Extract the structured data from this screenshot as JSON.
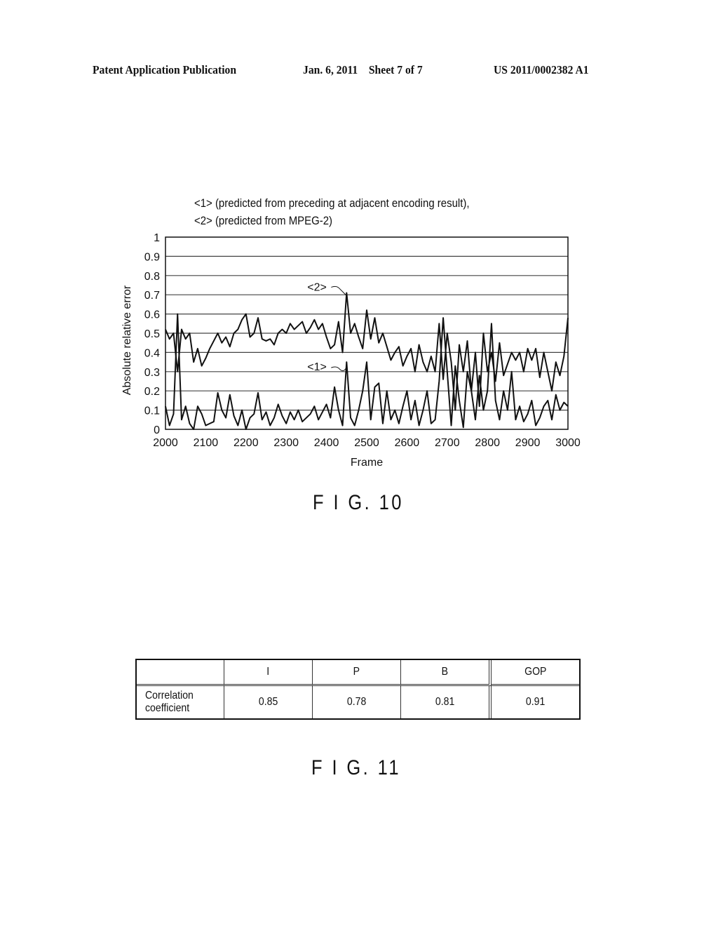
{
  "header": {
    "publication": "Patent Application Publication",
    "date_sheet": "Jan. 6, 2011    Sheet 7 of 7",
    "patent_number": "US 2011/0002382 A1"
  },
  "fig10": {
    "label": "F I G. 10"
  },
  "fig11": {
    "label": "F I G. 11"
  },
  "chart_data": {
    "type": "line",
    "title": "",
    "legend_text": [
      "<1> (predicted from preceding at adjacent encoding result),",
      "<2> (predicted from MPEG-2)"
    ],
    "xlabel": "Frame",
    "ylabel": "Absolute relative error",
    "xlim": [
      2000,
      3000
    ],
    "ylim": [
      0,
      1
    ],
    "x_ticks": [
      "2000",
      "2100",
      "2200",
      "2300",
      "2400",
      "2500",
      "2600",
      "2700",
      "2800",
      "2900",
      "3000"
    ],
    "y_ticks": [
      "0",
      "0.1",
      "0.2",
      "0.3",
      "0.4",
      "0.5",
      "0.6",
      "0.7",
      "0.8",
      "0.9",
      "1"
    ],
    "grid": "horizontal",
    "annotations": [
      {
        "text": "<2>",
        "x": 2450,
        "y": 0.71
      },
      {
        "text": "<1>",
        "x": 2450,
        "y": 0.35
      }
    ],
    "x": [
      2000,
      2010,
      2020,
      2030,
      2040,
      2050,
      2060,
      2070,
      2080,
      2090,
      2100,
      2110,
      2120,
      2130,
      2140,
      2150,
      2160,
      2170,
      2180,
      2190,
      2200,
      2210,
      2220,
      2230,
      2240,
      2250,
      2260,
      2270,
      2280,
      2290,
      2300,
      2310,
      2320,
      2330,
      2340,
      2350,
      2360,
      2370,
      2380,
      2390,
      2400,
      2410,
      2420,
      2430,
      2440,
      2450,
      2460,
      2470,
      2480,
      2490,
      2500,
      2510,
      2520,
      2530,
      2540,
      2550,
      2560,
      2570,
      2580,
      2590,
      2600,
      2610,
      2620,
      2630,
      2640,
      2650,
      2660,
      2670,
      2680,
      2690,
      2700,
      2710,
      2720,
      2730,
      2740,
      2750,
      2760,
      2770,
      2780,
      2790,
      2800,
      2810,
      2820,
      2830,
      2840,
      2850,
      2860,
      2870,
      2880,
      2890,
      2900,
      2910,
      2920,
      2930,
      2940,
      2950,
      2960,
      2970,
      2980,
      2990,
      3000
    ],
    "series": [
      {
        "name": "<1>",
        "values": [
          0.12,
          0.02,
          0.08,
          0.6,
          0.05,
          0.12,
          0.03,
          0.0,
          0.12,
          0.08,
          0.02,
          0.03,
          0.04,
          0.19,
          0.1,
          0.06,
          0.18,
          0.07,
          0.02,
          0.1,
          0.0,
          0.06,
          0.08,
          0.19,
          0.05,
          0.09,
          0.02,
          0.06,
          0.13,
          0.07,
          0.03,
          0.09,
          0.05,
          0.1,
          0.04,
          0.06,
          0.08,
          0.12,
          0.05,
          0.09,
          0.13,
          0.06,
          0.22,
          0.1,
          0.02,
          0.35,
          0.06,
          0.02,
          0.1,
          0.2,
          0.35,
          0.05,
          0.22,
          0.24,
          0.03,
          0.2,
          0.05,
          0.1,
          0.03,
          0.12,
          0.2,
          0.05,
          0.15,
          0.02,
          0.1,
          0.2,
          0.03,
          0.05,
          0.25,
          0.58,
          0.3,
          0.02,
          0.33,
          0.15,
          0.01,
          0.3,
          0.2,
          0.05,
          0.28,
          0.1,
          0.2,
          0.55,
          0.15,
          0.05,
          0.2,
          0.1,
          0.3,
          0.05,
          0.12,
          0.04,
          0.08,
          0.15,
          0.02,
          0.06,
          0.12,
          0.15,
          0.05,
          0.18,
          0.1,
          0.14,
          0.12
        ]
      },
      {
        "name": "<2>",
        "values": [
          0.52,
          0.47,
          0.5,
          0.3,
          0.52,
          0.47,
          0.5,
          0.35,
          0.42,
          0.33,
          0.37,
          0.42,
          0.46,
          0.5,
          0.45,
          0.48,
          0.43,
          0.5,
          0.52,
          0.57,
          0.6,
          0.48,
          0.5,
          0.58,
          0.47,
          0.46,
          0.47,
          0.44,
          0.5,
          0.52,
          0.5,
          0.55,
          0.52,
          0.54,
          0.56,
          0.5,
          0.53,
          0.57,
          0.52,
          0.55,
          0.48,
          0.42,
          0.44,
          0.56,
          0.4,
          0.71,
          0.5,
          0.55,
          0.48,
          0.42,
          0.62,
          0.47,
          0.58,
          0.45,
          0.5,
          0.43,
          0.36,
          0.4,
          0.43,
          0.33,
          0.38,
          0.42,
          0.3,
          0.44,
          0.35,
          0.3,
          0.38,
          0.3,
          0.55,
          0.26,
          0.5,
          0.35,
          0.1,
          0.44,
          0.3,
          0.46,
          0.2,
          0.4,
          0.12,
          0.5,
          0.3,
          0.4,
          0.25,
          0.45,
          0.28,
          0.34,
          0.4,
          0.36,
          0.4,
          0.3,
          0.42,
          0.36,
          0.42,
          0.27,
          0.4,
          0.3,
          0.2,
          0.35,
          0.28,
          0.38,
          0.58
        ]
      }
    ]
  },
  "table": {
    "headers": [
      "",
      "I",
      "P",
      "B",
      "GOP"
    ],
    "rows": [
      {
        "label_line1": "Correlation",
        "label_line2": "coefficient",
        "values": [
          "0.85",
          "0.78",
          "0.81",
          "0.91"
        ]
      }
    ]
  }
}
